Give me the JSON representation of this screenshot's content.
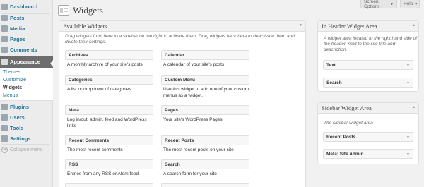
{
  "sidebar": {
    "menu": [
      {
        "label": "Dashboard",
        "icon": "dashboard-icon"
      },
      {
        "label": "Posts",
        "icon": "pin-icon"
      },
      {
        "label": "Media",
        "icon": "media-icon"
      },
      {
        "label": "Pages",
        "icon": "pages-icon"
      },
      {
        "label": "Comments",
        "icon": "comment-icon"
      },
      {
        "label": "Appearance",
        "icon": "appearance-icon"
      },
      {
        "label": "Plugins",
        "icon": "plugin-icon"
      },
      {
        "label": "Users",
        "icon": "users-icon"
      },
      {
        "label": "Tools",
        "icon": "tools-icon"
      },
      {
        "label": "Settings",
        "icon": "settings-icon"
      }
    ],
    "submenu": [
      "Themes",
      "Customize",
      "Widgets",
      "Menus"
    ],
    "collapse_label": "Collapse menu"
  },
  "header": {
    "title": "Widgets",
    "screen_options": "Screen Options",
    "help": "Help"
  },
  "available": {
    "title": "Available Widgets",
    "description": "Drag widgets from here to a sidebar on the right to activate them. Drag widgets back here to deactivate them and delete their settings.",
    "widgets": [
      {
        "name": "Archives",
        "desc": "A monthly archive of your site's posts"
      },
      {
        "name": "Calendar",
        "desc": "A calendar of your site's posts"
      },
      {
        "name": "Categories",
        "desc": "A list or dropdown of categories"
      },
      {
        "name": "Custom Menu",
        "desc": "Use this widget to add one of your custom menus as a widget."
      },
      {
        "name": "Meta",
        "desc": "Log in/out, admin, feed and WordPress links"
      },
      {
        "name": "Pages",
        "desc": "Your site's WordPress Pages"
      },
      {
        "name": "Recent Comments",
        "desc": "The most recent comments"
      },
      {
        "name": "Recent Posts",
        "desc": "The most recent posts on your site"
      },
      {
        "name": "RSS",
        "desc": "Entries from any RSS or Atom feed"
      },
      {
        "name": "Search",
        "desc": "A search form for your site"
      }
    ]
  },
  "header_area": {
    "title": "In Header Widget Area",
    "description": "A widget area located to the right hand side of the header, next to the site title and description.",
    "widgets": [
      "Text",
      "Search"
    ]
  },
  "sidebar_area": {
    "title": "Sidebar Widget Area",
    "description": "The sidebar widget area",
    "widgets": [
      "Recent Posts",
      "Meta: Site Admin"
    ]
  },
  "colors": {
    "link": "#21759b",
    "active_menu": "#6d6d6d",
    "panel_bg": "#ffffff"
  }
}
